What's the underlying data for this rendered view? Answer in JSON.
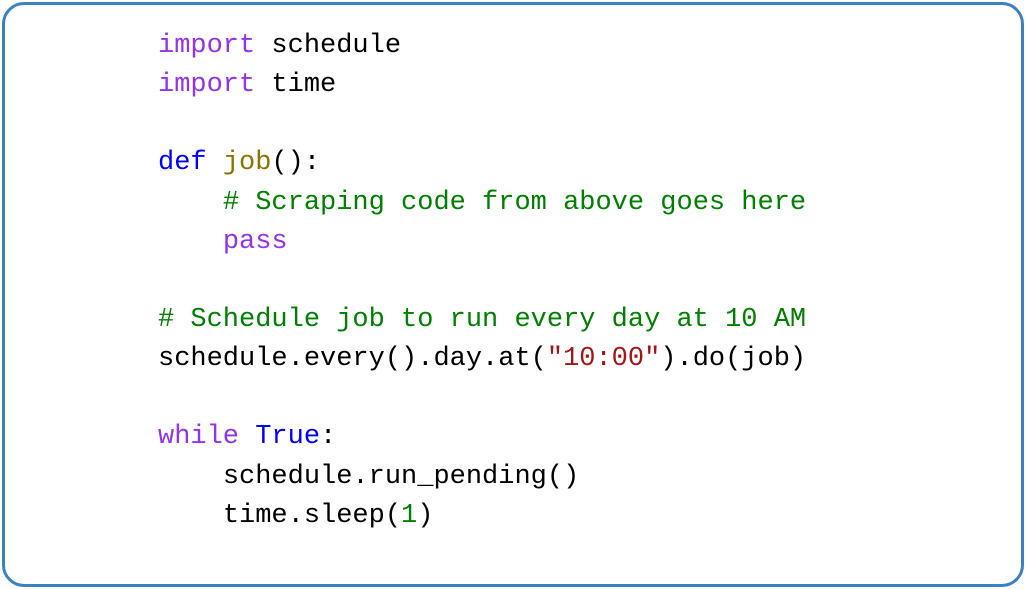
{
  "code": {
    "line1": {
      "import_kw": "import",
      "module": " schedule"
    },
    "line2": {
      "import_kw": "import",
      "module": " time"
    },
    "line3": "",
    "line4": {
      "def_kw": "def",
      "space": " ",
      "fn": "job",
      "parens": "():"
    },
    "line5": {
      "indent": "    ",
      "comment": "# Scraping code from above goes here"
    },
    "line6": {
      "indent": "    ",
      "pass_kw": "pass"
    },
    "line7": "",
    "line8": {
      "comment": "# Schedule job to run every day at 10 AM"
    },
    "line9": {
      "before": "schedule.every().day.at(",
      "str": "\"10:00\"",
      "after": ").do(job)"
    },
    "line10": "",
    "line11": {
      "while_kw": "while",
      "space": " ",
      "true_kw": "True",
      "colon": ":"
    },
    "line12": {
      "indent": "    ",
      "text": "schedule.run_pending()"
    },
    "line13": {
      "indent": "    ",
      "before": "time.sleep(",
      "num": "1",
      "after": ")"
    }
  }
}
